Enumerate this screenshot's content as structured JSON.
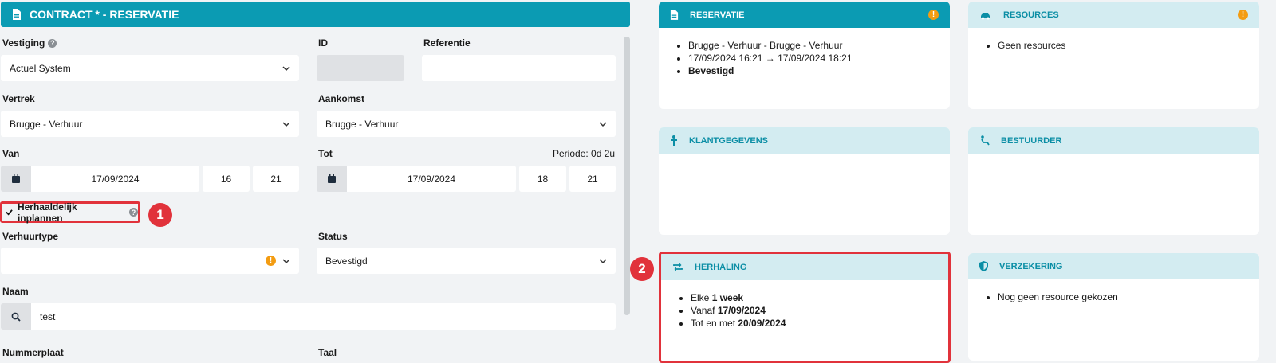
{
  "contract": {
    "title": "CONTRACT * - RESERVATIE"
  },
  "form": {
    "vestiging_label": "Vestiging",
    "vestiging_value": "Actuel System",
    "id_label": "ID",
    "id_value": "",
    "referentie_label": "Referentie",
    "referentie_value": "",
    "vertrek_label": "Vertrek",
    "vertrek_value": "Brugge - Verhuur",
    "aankomst_label": "Aankomst",
    "aankomst_value": "Brugge - Verhuur",
    "van_label": "Van",
    "van_date": "17/09/2024",
    "van_hour": "16",
    "van_min": "21",
    "tot_label": "Tot",
    "periode": "Periode: 0d 2u",
    "tot_date": "17/09/2024",
    "tot_hour": "18",
    "tot_min": "21",
    "herhaaldelijk_label": "Herhaaldelijk inplannen",
    "verhuurtype_label": "Verhuurtype",
    "verhuurtype_value": "",
    "status_label": "Status",
    "status_value": "Bevestigd",
    "naam_label": "Naam",
    "naam_value": "test",
    "nummerplaat_label": "Nummerplaat",
    "taal_label": "Taal"
  },
  "badges": {
    "one": "1",
    "two": "2"
  },
  "cards": {
    "reservatie": {
      "title": "RESERVATIE",
      "items": [
        "Brugge - Verhuur - Brugge - Verhuur",
        "17/09/2024 16:21 → 17/09/2024 18:21",
        "Bevestigd"
      ]
    },
    "resources": {
      "title": "RESOURCES",
      "items": [
        "Geen resources"
      ]
    },
    "klantgegevens": {
      "title": "KLANTGEGEVENS"
    },
    "bestuurder": {
      "title": "BESTUURDER"
    },
    "herhaling": {
      "title": "HERHALING",
      "item1_prefix": "Elke ",
      "item1_bold": "1 week",
      "item2_prefix": "Vanaf ",
      "item2_bold": "17/09/2024",
      "item3_prefix": "Tot en met ",
      "item3_bold": "20/09/2024"
    },
    "verzekering": {
      "title": "VERZEKERING",
      "items": [
        "Nog geen resource gekozen"
      ]
    }
  },
  "colors": {
    "accent": "#0b9bb3",
    "header_light": "#d3ecf1",
    "highlight": "#e1323b",
    "warning": "#f39c12"
  }
}
